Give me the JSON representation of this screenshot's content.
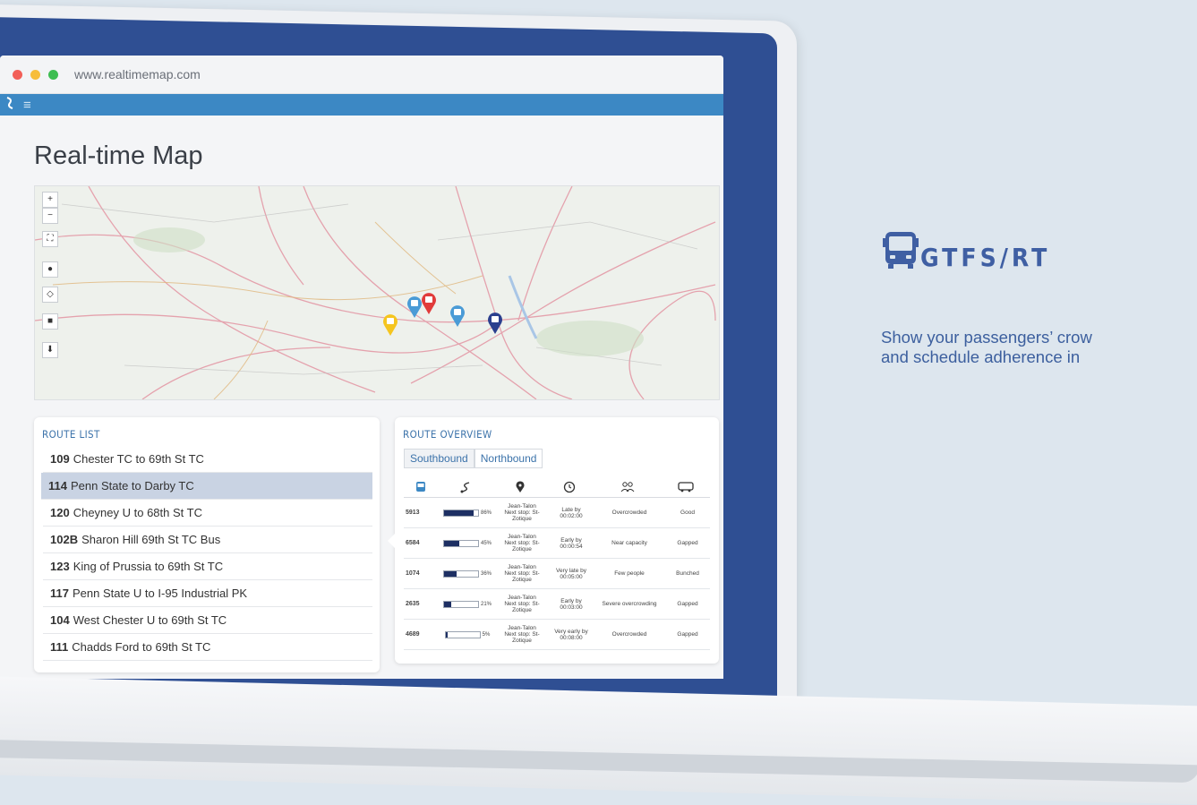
{
  "browser": {
    "url": "www.realtimemap.com"
  },
  "app": {
    "page_title": "Real-time Map",
    "menu_icon": "hamburger-icon"
  },
  "map": {
    "controls": [
      "+",
      "−",
      "⛶",
      "●",
      "◇",
      "■",
      "⬇"
    ],
    "pins": [
      {
        "color": "#f5c51f"
      },
      {
        "color": "#4a9bd6"
      },
      {
        "color": "#e13b3b"
      },
      {
        "color": "#4a9bd6"
      },
      {
        "color": "#2b3f8e"
      }
    ]
  },
  "route_list": {
    "title": "ROUTE LIST",
    "items": [
      {
        "num": "109",
        "name": "Chester TC to 69th St TC",
        "selected": false
      },
      {
        "num": "114",
        "name": "Penn State to Darby TC",
        "selected": true
      },
      {
        "num": "120",
        "name": "Cheyney U to 68th St TC",
        "selected": false
      },
      {
        "num": "102B",
        "name": "Sharon Hill 69th St TC Bus",
        "selected": false
      },
      {
        "num": "123",
        "name": "King of Prussia to 69th St TC",
        "selected": false
      },
      {
        "num": "117",
        "name": "Penn State U to I-95 Industrial PK",
        "selected": false
      },
      {
        "num": "104",
        "name": "West Chester U to 69th St TC",
        "selected": false
      },
      {
        "num": "111",
        "name": "Chadds Ford to 69th St TC",
        "selected": false
      }
    ]
  },
  "route_overview": {
    "title": "ROUTE OVERVIEW",
    "tabs": [
      "Southbound",
      "Northbound"
    ],
    "columns": [
      "bus-icon",
      "route-icon",
      "location-pin-icon",
      "clock-icon",
      "people-icon",
      "bus-front-icon"
    ],
    "rows": [
      {
        "id": "5913",
        "load": 0.86,
        "pct": "86%",
        "stop": "Jean-Talon",
        "next": "Next stop: St-Zotique",
        "status": "Late by",
        "time": "00:02:00",
        "crowd": "Overcrowded",
        "spacing": "Good"
      },
      {
        "id": "6584",
        "load": 0.45,
        "pct": "45%",
        "stop": "Jean-Talon",
        "next": "Next stop: St-Zotique",
        "status": "Early by",
        "time": "00:00:54",
        "crowd": "Near capacity",
        "spacing": "Gapped"
      },
      {
        "id": "1074",
        "load": 0.36,
        "pct": "36%",
        "stop": "Jean-Talon",
        "next": "Next stop: St-Zotique",
        "status": "Very late by",
        "time": "00:05:00",
        "crowd": "Few people",
        "spacing": "Bunched"
      },
      {
        "id": "2635",
        "load": 0.21,
        "pct": "21%",
        "stop": "Jean-Talon",
        "next": "Next stop: St-Zotique",
        "status": "Early by",
        "time": "00:03:00",
        "crowd": "Severe overcrowding",
        "spacing": "Gapped"
      },
      {
        "id": "4689",
        "load": 0.05,
        "pct": "5%",
        "stop": "Jean-Talon",
        "next": "Next stop: St-Zotique",
        "status": "Very early by",
        "time": "00:08:00",
        "crowd": "Overcrowded",
        "spacing": "Gapped"
      }
    ]
  },
  "promo": {
    "brand": "GTFS/RT",
    "icon": "bus-icon",
    "tagline_1": "Show your passengers’ crow",
    "tagline_2": "and schedule adherence in"
  },
  "colors": {
    "accent": "#3c88c4",
    "brand": "#3f5fa3",
    "bezel": "#2f4f93"
  }
}
